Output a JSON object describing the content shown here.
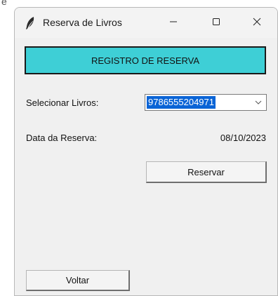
{
  "stray_text": "e",
  "window": {
    "title": "Reserva de Livros",
    "icon": "feather-icon",
    "controls": {
      "minimize": "minimize-icon",
      "maximize": "maximize-icon",
      "close": "close-icon"
    }
  },
  "header": {
    "text": "REGISTRO DE RESERVA",
    "bg_color": "#3ecfd6"
  },
  "form": {
    "livros_label": "Selecionar Livros:",
    "livros_selected": "9786555204971",
    "data_label": "Data da Reserva:",
    "data_value": "08/10/2023"
  },
  "buttons": {
    "reservar": "Reservar",
    "voltar": "Voltar"
  },
  "colors": {
    "selection": "#0a64d6",
    "window_bg": "#f0f0f0"
  }
}
